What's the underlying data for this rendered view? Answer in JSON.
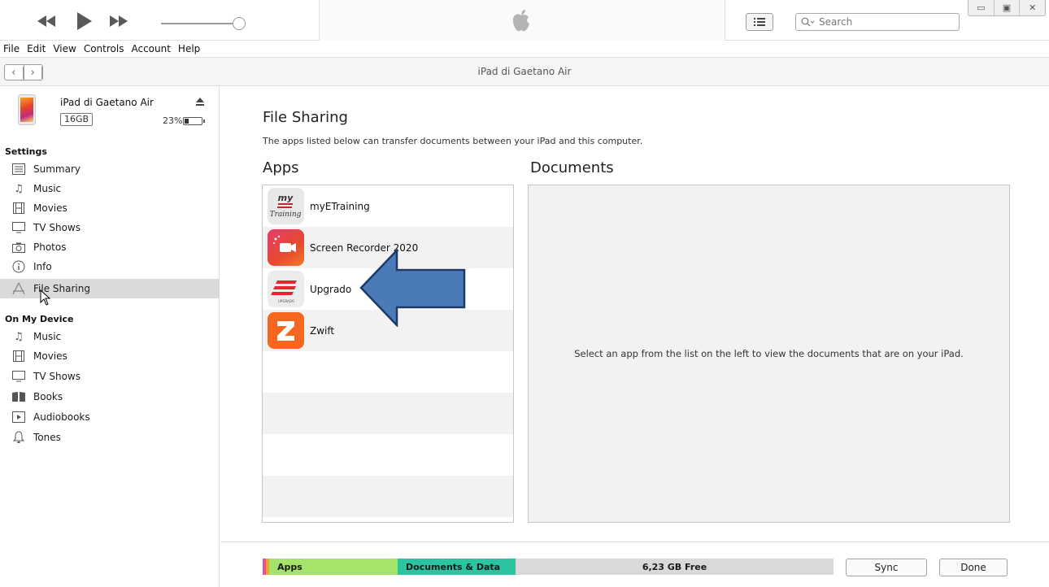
{
  "toolbar": {
    "search_placeholder": "Search",
    "icons": [
      "rewind-icon",
      "play-icon",
      "fast-forward-icon",
      "apple-logo-icon",
      "list-view-icon",
      "search-icon"
    ]
  },
  "menubar": {
    "items": [
      "File",
      "Edit",
      "View",
      "Controls",
      "Account",
      "Help"
    ]
  },
  "navbar": {
    "title": "iPad di Gaetano Air"
  },
  "device": {
    "name": "iPad di Gaetano Air",
    "capacity": "16GB",
    "battery": "23%",
    "battery_level": 0.23
  },
  "sidebar": {
    "settings_header": "Settings",
    "settings_items": [
      {
        "label": "Summary",
        "icon": "summary-icon"
      },
      {
        "label": "Music",
        "icon": "music-note-icon"
      },
      {
        "label": "Movies",
        "icon": "film-icon"
      },
      {
        "label": "TV Shows",
        "icon": "tv-icon"
      },
      {
        "label": "Photos",
        "icon": "camera-icon"
      },
      {
        "label": "Info",
        "icon": "info-icon"
      },
      {
        "label": "File Sharing",
        "icon": "file-sharing-icon",
        "selected": true
      }
    ],
    "device_header": "On My Device",
    "device_items": [
      {
        "label": "Music",
        "icon": "music-note-icon"
      },
      {
        "label": "Movies",
        "icon": "film-icon"
      },
      {
        "label": "TV Shows",
        "icon": "tv-icon"
      },
      {
        "label": "Books",
        "icon": "books-icon"
      },
      {
        "label": "Audiobooks",
        "icon": "audiobook-icon"
      },
      {
        "label": "Tones",
        "icon": "bell-icon"
      }
    ]
  },
  "main": {
    "title": "File Sharing",
    "description": "The apps listed below can transfer documents between your iPad and this computer.",
    "apps_heading": "Apps",
    "documents_heading": "Documents",
    "apps": [
      {
        "name": "myETraining"
      },
      {
        "name": "Screen Recorder 2020"
      },
      {
        "name": "Upgrado"
      },
      {
        "name": "Zwift"
      }
    ],
    "documents_empty": "Select an app from the list on the left to view the documents that are on your iPad."
  },
  "footer": {
    "capacity_segments": {
      "apps": "Apps",
      "docs": "Documents & Data",
      "free": "6,23 GB Free"
    },
    "sync_label": "Sync",
    "done_label": "Done"
  },
  "colors": {
    "selected_row": "#dadada",
    "apps_segment": "#a5e36b",
    "docs_segment": "#2cc3a0",
    "free_segment": "#d9d9d9",
    "arrow": "#4a7ab8"
  }
}
